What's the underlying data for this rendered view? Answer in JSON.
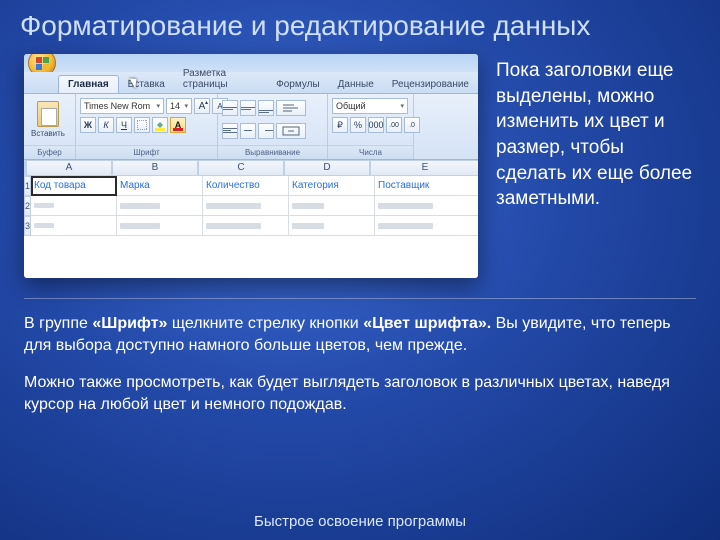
{
  "slide": {
    "title": "Форматирование и редактирование данных",
    "footer": "Быстрое освоение программы"
  },
  "side_text": "Пока заголовки еще выделены, можно изменить их цвет и размер, чтобы сделать их еще более заметными.",
  "body": {
    "p1_a": "В группе ",
    "p1_b": "«Шрифт»",
    "p1_c": " щелкните стрелку кнопки ",
    "p1_d": "«Цвет шрифта».",
    "p1_e": " Вы увидите, что теперь для выбора доступно намного больше цветов, чем прежде.",
    "p2": "Можно также просмотреть, как будет выглядеть заголовок в различных цветах, наведя курсор на любой цвет и немного подождав."
  },
  "ribbon": {
    "tabs": [
      "Главная",
      "Вставка",
      "Разметка страницы",
      "Формулы",
      "Данные",
      "Рецензирование"
    ],
    "paste_label": "Вставить",
    "groups": {
      "clipboard": "Буфер обмена",
      "font": "Шрифт",
      "align": "Выравнивание",
      "number": "Числа"
    },
    "font_name": "Times New Rom",
    "font_size": "14",
    "bold": "Ж",
    "italic": "К",
    "underline": "Ч",
    "grow": "A",
    "shrink": "A",
    "number_format": "Общий"
  },
  "grid": {
    "cols": [
      "A",
      "B",
      "C",
      "D",
      "E"
    ],
    "rows": [
      "1",
      "2",
      "3"
    ],
    "headers": [
      "Код товара",
      "Марка",
      "Количество",
      "Категория",
      "Поставщик"
    ]
  }
}
